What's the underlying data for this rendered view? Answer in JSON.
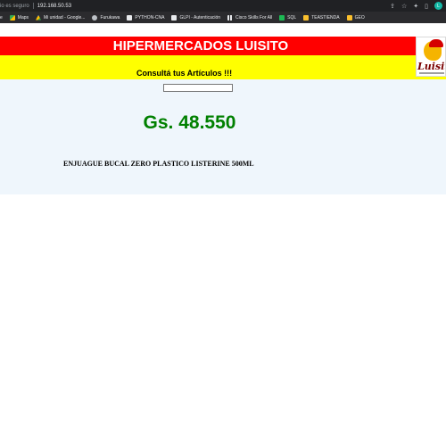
{
  "browser": {
    "security_label": "io es seguro",
    "url": "192.168.50.53",
    "avatar_letter": "L"
  },
  "bookmarks": [
    {
      "label": "e",
      "icon": "edge-icon"
    },
    {
      "label": "Maps",
      "icon": "maps-icon"
    },
    {
      "label": "Mi unidad - Google...",
      "icon": "drive-icon"
    },
    {
      "label": "Furukawa",
      "icon": "globe-icon"
    },
    {
      "label": "PYTHON-CNA",
      "icon": "page-icon"
    },
    {
      "label": "GLPI - Autenticación",
      "icon": "windows-icon"
    },
    {
      "label": "Cisco Skills For All",
      "icon": "grid-icon"
    },
    {
      "label": "SQL",
      "icon": "w-icon"
    },
    {
      "label": "TEASTIENDA",
      "icon": "folder-icon"
    },
    {
      "label": "GEO",
      "icon": "folder-icon"
    }
  ],
  "page": {
    "store_name": "HIPERMERCADOS LUISITO",
    "subtitle": "Consultá tus Artículos !!!",
    "search_value": "",
    "price": "Gs. 48.550",
    "product_name": "ENJUAGUE BUCAL ZERO PLASTICO LISTERINE 500ML",
    "logo_text": "Luisito"
  },
  "colors": {
    "header_red": "#ff0000",
    "header_yellow": "#ffff00",
    "price_green": "#008000",
    "content_bg": "#eff6fc"
  }
}
